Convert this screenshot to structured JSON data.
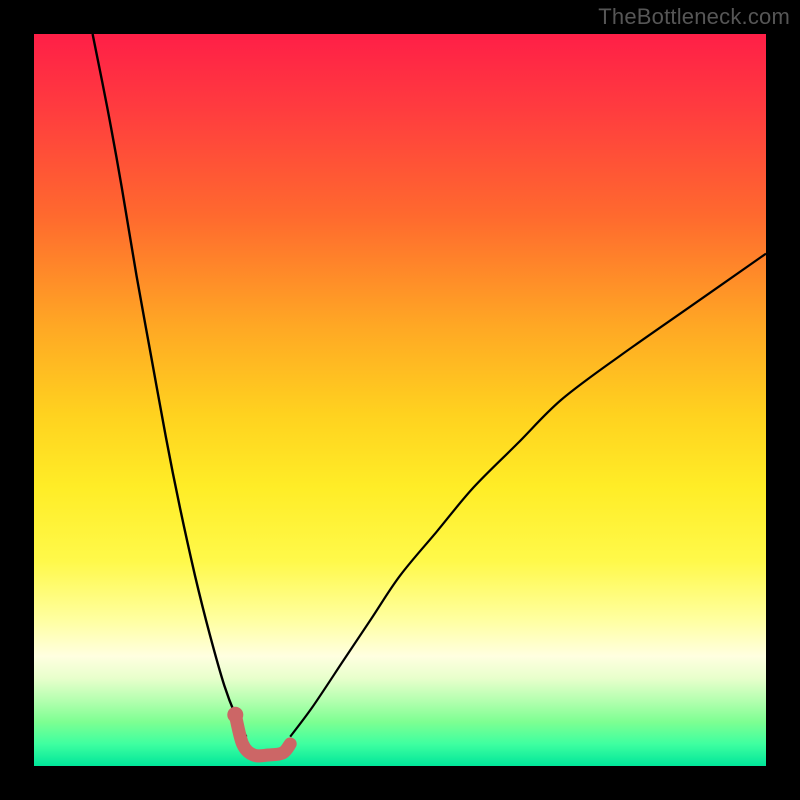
{
  "watermark": "TheBottleneck.com",
  "colors": {
    "frame_bg": "#000000",
    "curve_stroke": "#000000",
    "marker_stroke": "#cc6666",
    "marker_fill": "#cc6666"
  },
  "chart_data": {
    "type": "line",
    "title": "",
    "xlabel": "",
    "ylabel": "",
    "xlim": [
      0,
      100
    ],
    "ylim": [
      0,
      100
    ],
    "note": "Bottleneck-style V curve. Values are estimated from pixel positions; the chart has no tick labels so precision is coarse (nearest ~2 units).",
    "series": [
      {
        "name": "left-branch",
        "x": [
          8,
          10,
          12,
          14,
          16,
          18,
          20,
          22,
          24,
          26,
          27.5,
          29
        ],
        "y": [
          100,
          90,
          79,
          67,
          56,
          45,
          35,
          26,
          18,
          11,
          7,
          4
        ]
      },
      {
        "name": "right-branch",
        "x": [
          35,
          38,
          42,
          46,
          50,
          55,
          60,
          66,
          72,
          80,
          90,
          100
        ],
        "y": [
          4,
          8,
          14,
          20,
          26,
          32,
          38,
          44,
          50,
          56,
          63,
          70
        ]
      },
      {
        "name": "valley-marker",
        "x": [
          27.5,
          28.5,
          30,
          32,
          34,
          35
        ],
        "y": [
          7,
          3,
          1.5,
          1.5,
          1.8,
          3
        ]
      }
    ],
    "marker_dot": {
      "x": 27.5,
      "y": 7
    }
  }
}
